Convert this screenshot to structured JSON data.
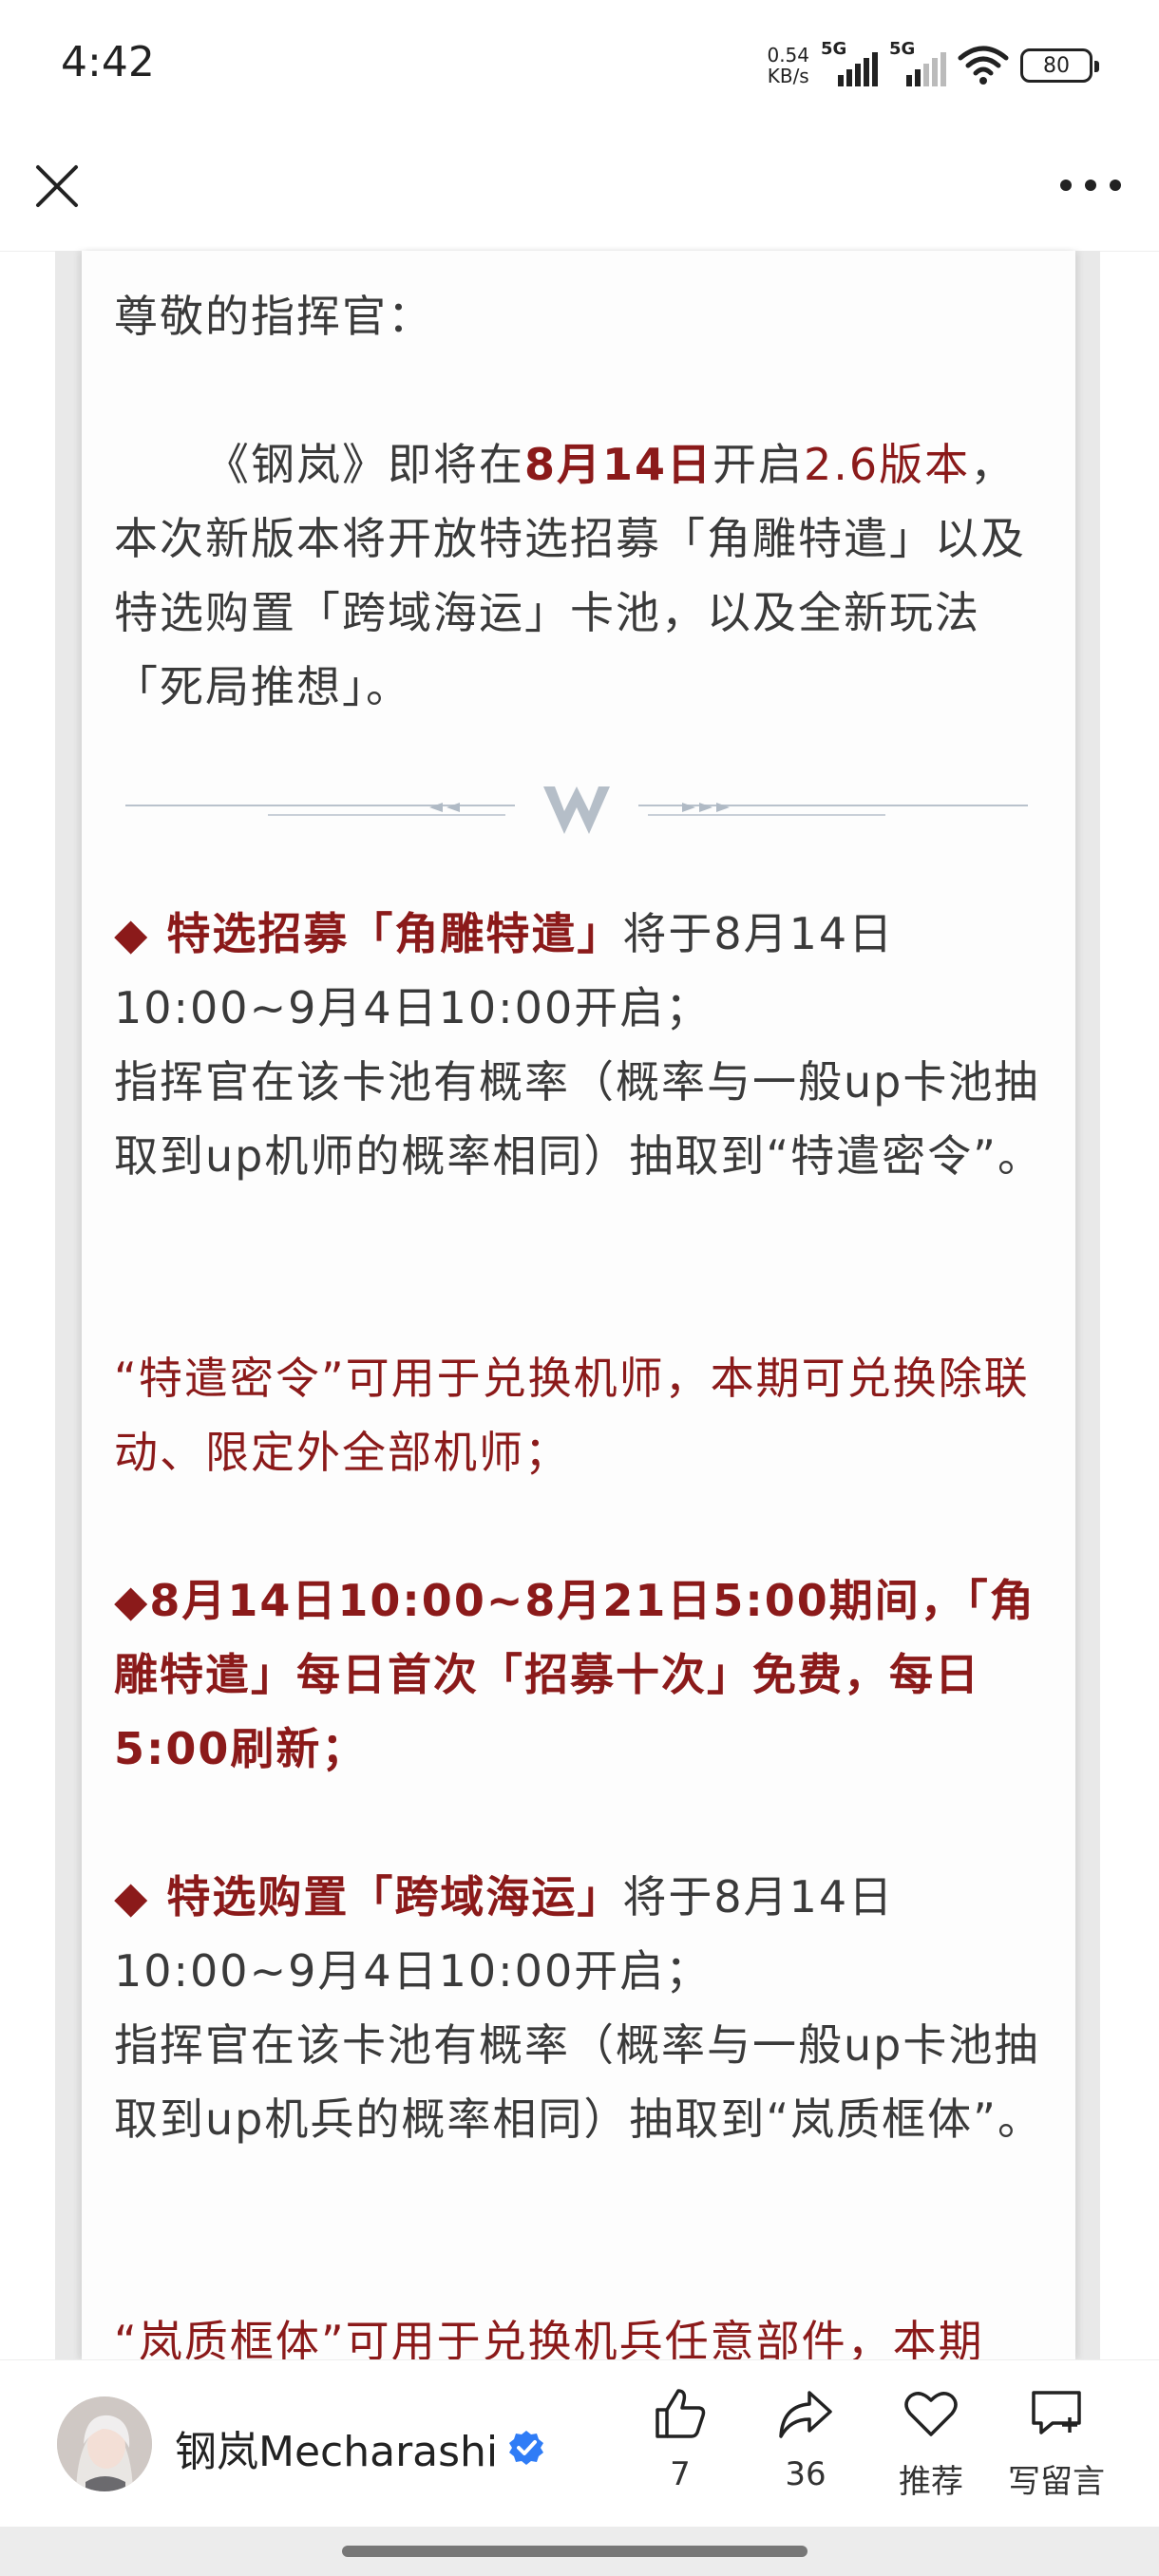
{
  "status": {
    "time": "4:42",
    "net_speed_value": "0.54",
    "net_speed_unit": "KB/s",
    "signal1": "5G",
    "signal2": "5G",
    "battery": "80"
  },
  "article": {
    "greeting": "尊敬的指挥官：",
    "intro": {
      "p1": "《钢岚》即将在",
      "date": "8月14日",
      "p2": "开启",
      "version": "2.6版本",
      "p3": "，本次新版本将开放特选招募「角雕特遣」以及特选购置「跨域海运」卡池，以及全新玩法「死局推想」。"
    },
    "section1": {
      "title": "◆ 特选招募「角雕特遣」",
      "time": "将于8月14日10:00~9月4日10:00开启；",
      "desc": "指挥官在该卡池有概率（概率与一般up卡池抽取到up机师的概率相同）抽取到“特遣密令”。",
      "note": "“特遣密令”可用于兑换机师，本期可兑换除联动、限定外全部机师；"
    },
    "free": "◆8月14日10:00~8月21日5:00期间，「角雕特遣」每日首次「招募十次」免费，每日5:00刷新；",
    "section2": {
      "title": "◆ 特选购置「跨域海运」",
      "time": "将于8月14日10:00~9月4日10:00开启；",
      "desc": "指挥官在该卡池有概率（概率与一般up卡池抽取到up机兵的概率相同）抽取到“岚质框体”。",
      "note": "“岚质框体”可用于兑换机兵任意部件，本期"
    }
  },
  "footer": {
    "author": "钢岚Mecharashi",
    "like_count": "7",
    "share_count": "36",
    "recommend_label": "推荐",
    "comment_label": "写留言"
  },
  "colors": {
    "accent": "#8b1a1a",
    "text": "#3a3a3a",
    "verified": "#2f7cf6"
  }
}
